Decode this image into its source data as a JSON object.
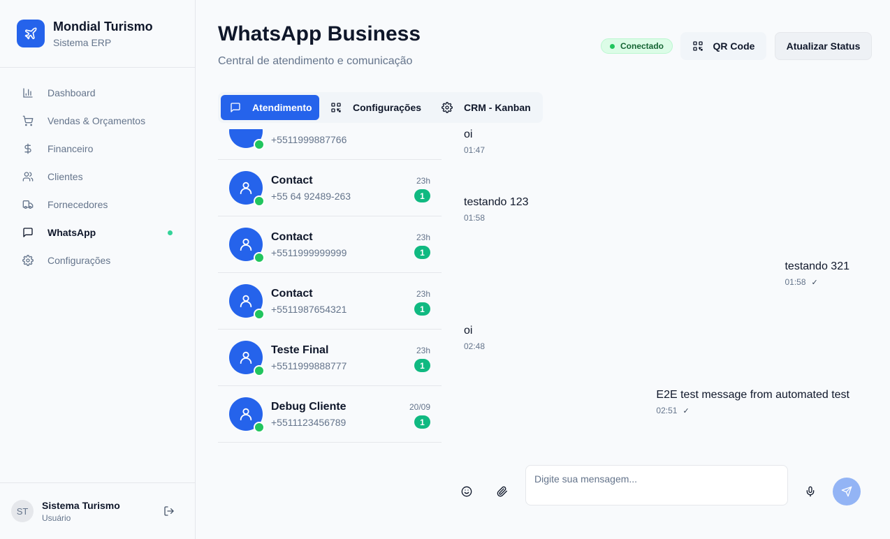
{
  "brand": {
    "name": "Mondial Turismo",
    "subtitle": "Sistema ERP"
  },
  "sidebar": {
    "items": [
      {
        "label": "Dashboard",
        "icon": "bar-chart-icon",
        "active": false
      },
      {
        "label": "Vendas & Orçamentos",
        "icon": "cart-icon",
        "active": false
      },
      {
        "label": "Financeiro",
        "icon": "dollar-icon",
        "active": false
      },
      {
        "label": "Clientes",
        "icon": "users-icon",
        "active": false
      },
      {
        "label": "Fornecedores",
        "icon": "truck-icon",
        "active": false
      },
      {
        "label": "WhatsApp",
        "icon": "message-icon",
        "active": true,
        "indicator_color": "#34d399"
      },
      {
        "label": "Configurações",
        "icon": "gear-icon",
        "active": false
      }
    ]
  },
  "user": {
    "initials": "ST",
    "name": "Sistema Turismo",
    "role": "Usuário"
  },
  "header": {
    "title": "WhatsApp Business",
    "subtitle": "Central de atendimento e comunicação",
    "status": "Conectado",
    "qr_label": "QR Code",
    "refresh_label": "Atualizar Status"
  },
  "tabs": [
    {
      "label": "Atendimento",
      "icon": "message-icon",
      "active": true
    },
    {
      "label": "Configurações",
      "icon": "qr-code-icon",
      "active": false
    },
    {
      "label": "CRM - Kanban",
      "icon": "gear-icon",
      "active": false
    }
  ],
  "contacts": [
    {
      "name": "",
      "phone": "+5511999887766",
      "time": "",
      "unread": ""
    },
    {
      "name": "Contact",
      "phone": "+55 64 92489-263",
      "time": "23h",
      "unread": "1"
    },
    {
      "name": "Contact",
      "phone": "+5511999999999",
      "time": "23h",
      "unread": "1"
    },
    {
      "name": "Contact",
      "phone": "+5511987654321",
      "time": "23h",
      "unread": "1"
    },
    {
      "name": "Teste Final",
      "phone": "+5511999888777",
      "time": "23h",
      "unread": "1"
    },
    {
      "name": "Debug Cliente",
      "phone": "+5511123456789",
      "time": "20/09",
      "unread": "1"
    }
  ],
  "messages": [
    {
      "text": "oi",
      "time": "01:47",
      "outgoing": false
    },
    {
      "text": "testando 123",
      "time": "01:58",
      "outgoing": false
    },
    {
      "text": "testando 321",
      "time": "01:58",
      "outgoing": true,
      "status": "✓"
    },
    {
      "text": "oi",
      "time": "02:48",
      "outgoing": false
    },
    {
      "text": "E2E test message from automated test",
      "time": "02:51",
      "outgoing": true,
      "status": "✓"
    }
  ],
  "composer": {
    "placeholder": "Digite sua mensagem..."
  },
  "colors": {
    "primary": "#2563eb",
    "online": "#22c55e",
    "unread": "#10b981",
    "connected_bg": "#dcfce7"
  }
}
